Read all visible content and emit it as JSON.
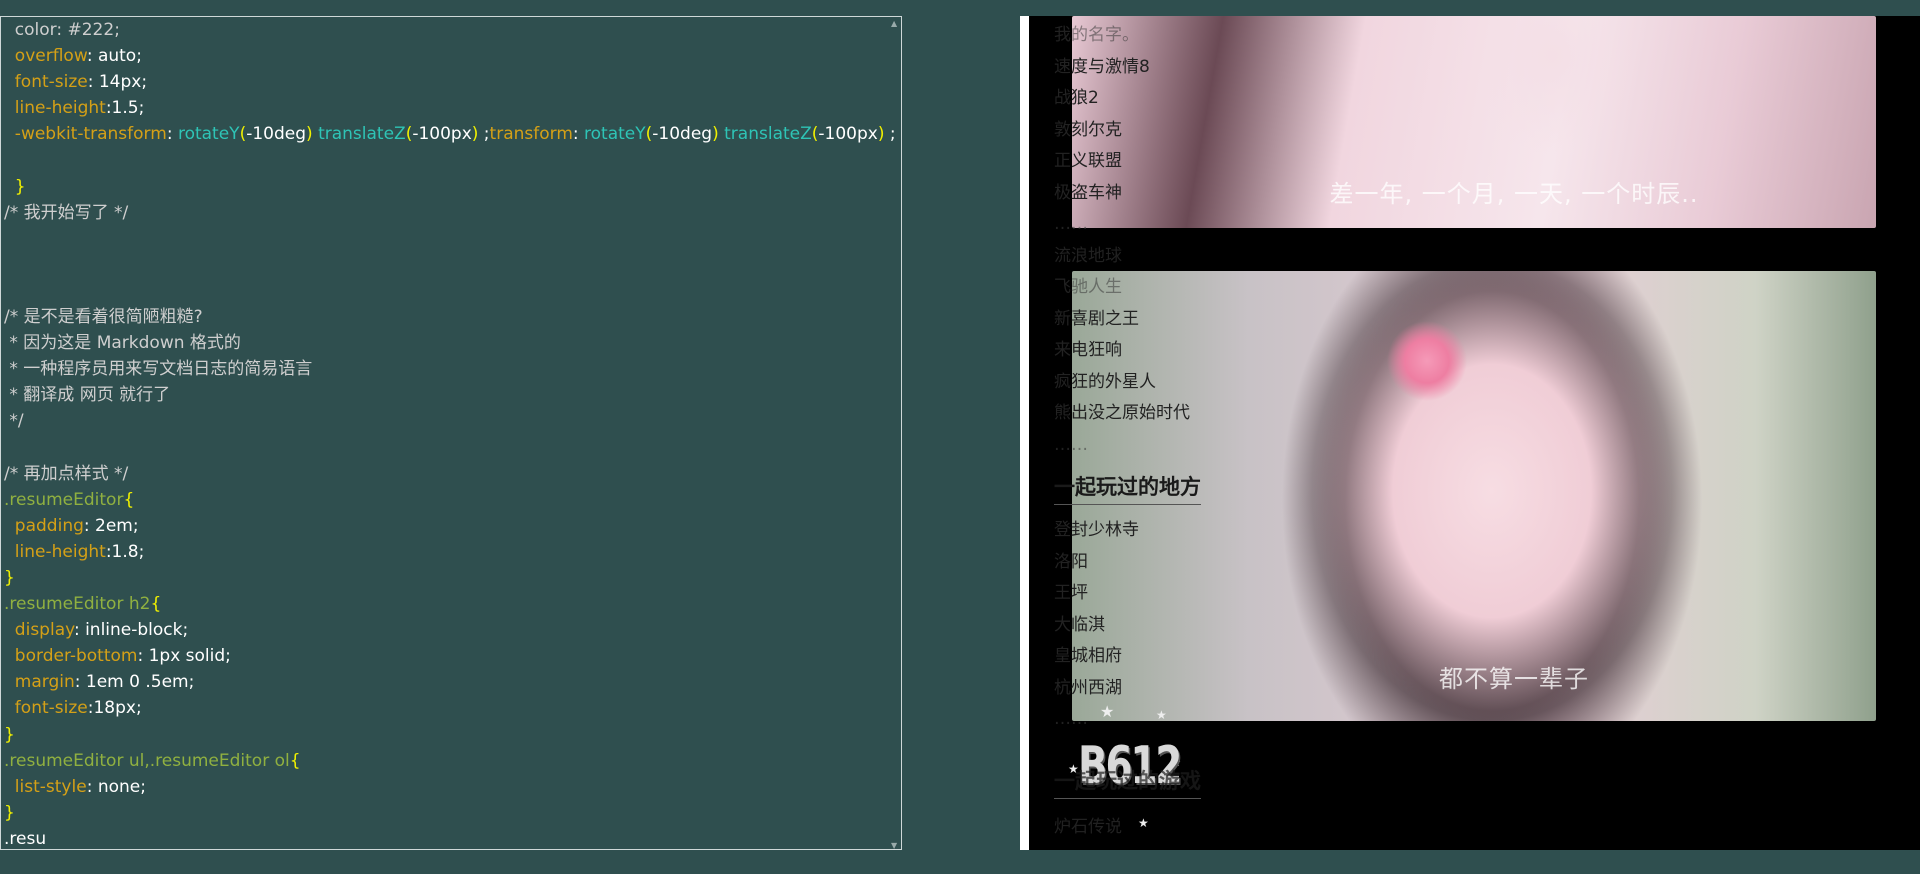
{
  "code": {
    "lines": [
      [
        {
          "t": "  color: #222;",
          "c": "c-cmt"
        }
      ],
      [
        {
          "t": "  overflow",
          "c": "c-prop"
        },
        {
          "t": ": auto;",
          "c": "c-val"
        }
      ],
      [
        {
          "t": "  font-size",
          "c": "c-prop"
        },
        {
          "t": ": 14px;",
          "c": "c-val"
        }
      ],
      [
        {
          "t": "  line-height",
          "c": "c-prop"
        },
        {
          "t": ":1.5;",
          "c": "c-val"
        }
      ],
      [
        {
          "t": "  -webkit-transform",
          "c": "c-prop"
        },
        {
          "t": ": ",
          "c": "c-val"
        },
        {
          "t": "rotateY",
          "c": "c-fn"
        },
        {
          "t": "(",
          "c": "c-brace"
        },
        {
          "t": "-10deg",
          "c": "c-val"
        },
        {
          "t": ")",
          "c": "c-brace"
        },
        {
          "t": " ",
          "c": "c-val"
        },
        {
          "t": "translateZ",
          "c": "c-fn"
        },
        {
          "t": "(",
          "c": "c-brace"
        },
        {
          "t": "-100px",
          "c": "c-val"
        },
        {
          "t": ")",
          "c": "c-brace"
        },
        {
          "t": " ;",
          "c": "c-val"
        },
        {
          "t": "transform",
          "c": "c-prop"
        },
        {
          "t": ": ",
          "c": "c-val"
        },
        {
          "t": "rotateY",
          "c": "c-fn"
        },
        {
          "t": "(",
          "c": "c-brace"
        },
        {
          "t": "-10deg",
          "c": "c-val"
        },
        {
          "t": ")",
          "c": "c-brace"
        },
        {
          "t": " ",
          "c": "c-val"
        },
        {
          "t": "translateZ",
          "c": "c-fn"
        },
        {
          "t": "(",
          "c": "c-brace"
        },
        {
          "t": "-100px",
          "c": "c-val"
        },
        {
          "t": ")",
          "c": "c-brace"
        },
        {
          "t": " ;",
          "c": "c-val"
        }
      ],
      [
        {
          "t": "",
          "c": "c-val"
        }
      ],
      [
        {
          "t": "  }",
          "c": "c-brace"
        }
      ],
      [
        {
          "t": "/* 我开始写了 */",
          "c": "c-cmt"
        }
      ],
      [
        {
          "t": "",
          "c": "c-val"
        }
      ],
      [
        {
          "t": "",
          "c": "c-val"
        }
      ],
      [
        {
          "t": "",
          "c": "c-val"
        }
      ],
      [
        {
          "t": "/* 是不是看着很简陋粗糙?",
          "c": "c-cmt"
        }
      ],
      [
        {
          "t": " * 因为这是 Markdown 格式的",
          "c": "c-cmt"
        }
      ],
      [
        {
          "t": " * 一种程序员用来写文档日志的简易语言",
          "c": "c-cmt"
        }
      ],
      [
        {
          "t": " * 翻译成 网页 就行了",
          "c": "c-cmt"
        }
      ],
      [
        {
          "t": " */",
          "c": "c-cmt"
        }
      ],
      [
        {
          "t": "",
          "c": "c-val"
        }
      ],
      [
        {
          "t": "/* 再加点样式 */",
          "c": "c-cmt"
        }
      ],
      [
        {
          "t": ".resumeEditor",
          "c": "c-sel"
        },
        {
          "t": "{",
          "c": "c-brace"
        }
      ],
      [
        {
          "t": "  padding",
          "c": "c-prop"
        },
        {
          "t": ": 2em;",
          "c": "c-val"
        }
      ],
      [
        {
          "t": "  line-height",
          "c": "c-prop"
        },
        {
          "t": ":1.8;",
          "c": "c-val"
        }
      ],
      [
        {
          "t": "}",
          "c": "c-brace"
        }
      ],
      [
        {
          "t": ".resumeEditor h2",
          "c": "c-sel"
        },
        {
          "t": "{",
          "c": "c-brace"
        }
      ],
      [
        {
          "t": "  display",
          "c": "c-prop"
        },
        {
          "t": ": inline-block;",
          "c": "c-val"
        }
      ],
      [
        {
          "t": "  border-bottom",
          "c": "c-prop"
        },
        {
          "t": ": 1px solid;",
          "c": "c-val"
        }
      ],
      [
        {
          "t": "  margin",
          "c": "c-prop"
        },
        {
          "t": ": 1em 0 .5em;",
          "c": "c-val"
        }
      ],
      [
        {
          "t": "  font-size",
          "c": "c-prop"
        },
        {
          "t": ":18px;",
          "c": "c-val"
        }
      ],
      [
        {
          "t": "}",
          "c": "c-brace"
        }
      ],
      [
        {
          "t": ".resumeEditor ul,.resumeEditor ol",
          "c": "c-sel"
        },
        {
          "t": "{",
          "c": "c-brace"
        }
      ],
      [
        {
          "t": "  list-style",
          "c": "c-prop"
        },
        {
          "t": ": none;",
          "c": "c-val"
        }
      ],
      [
        {
          "t": "}",
          "c": "c-brace"
        }
      ],
      [
        {
          "t": ".resu",
          "c": "c-val"
        }
      ]
    ]
  },
  "resume": {
    "movies": [
      {
        "label": "我的名字。",
        "faded": true
      },
      {
        "label": "速度与激情8",
        "faded": false
      },
      {
        "label": "战狼2",
        "faded": false
      },
      {
        "label": "敦刻尔克",
        "faded": false
      },
      {
        "label": "正义联盟",
        "faded": false
      },
      {
        "label": "极盗车神",
        "faded": false
      },
      {
        "label": "……",
        "faded": true
      },
      {
        "label": "流浪地球",
        "faded": true
      },
      {
        "label": "飞驰人生",
        "faded": true
      },
      {
        "label": "新喜剧之王",
        "faded": false
      },
      {
        "label": "来电狂响",
        "faded": false
      },
      {
        "label": "疯狂的外星人",
        "faded": false
      },
      {
        "label": "熊出没之原始时代",
        "faded": false
      },
      {
        "label": "……",
        "faded": true
      }
    ],
    "places_heading": "一起玩过的地方",
    "places": [
      {
        "label": "登封少林寺",
        "faded": false
      },
      {
        "label": "洛阳",
        "faded": false
      },
      {
        "label": "王坪",
        "faded": false
      },
      {
        "label": "大临淇",
        "faded": false
      },
      {
        "label": "皇城相府",
        "faded": false
      },
      {
        "label": "杭州西湖",
        "faded": false
      },
      {
        "label": "……",
        "faded": true
      }
    ],
    "games_heading": "一起玩过的游戏",
    "games": [
      {
        "label": "炉石传说",
        "faded": true
      }
    ],
    "caption_1": "差一年, 一个月, 一天, 一个时辰..",
    "caption_2": "都不算一辈子",
    "logo_text": "B612"
  }
}
